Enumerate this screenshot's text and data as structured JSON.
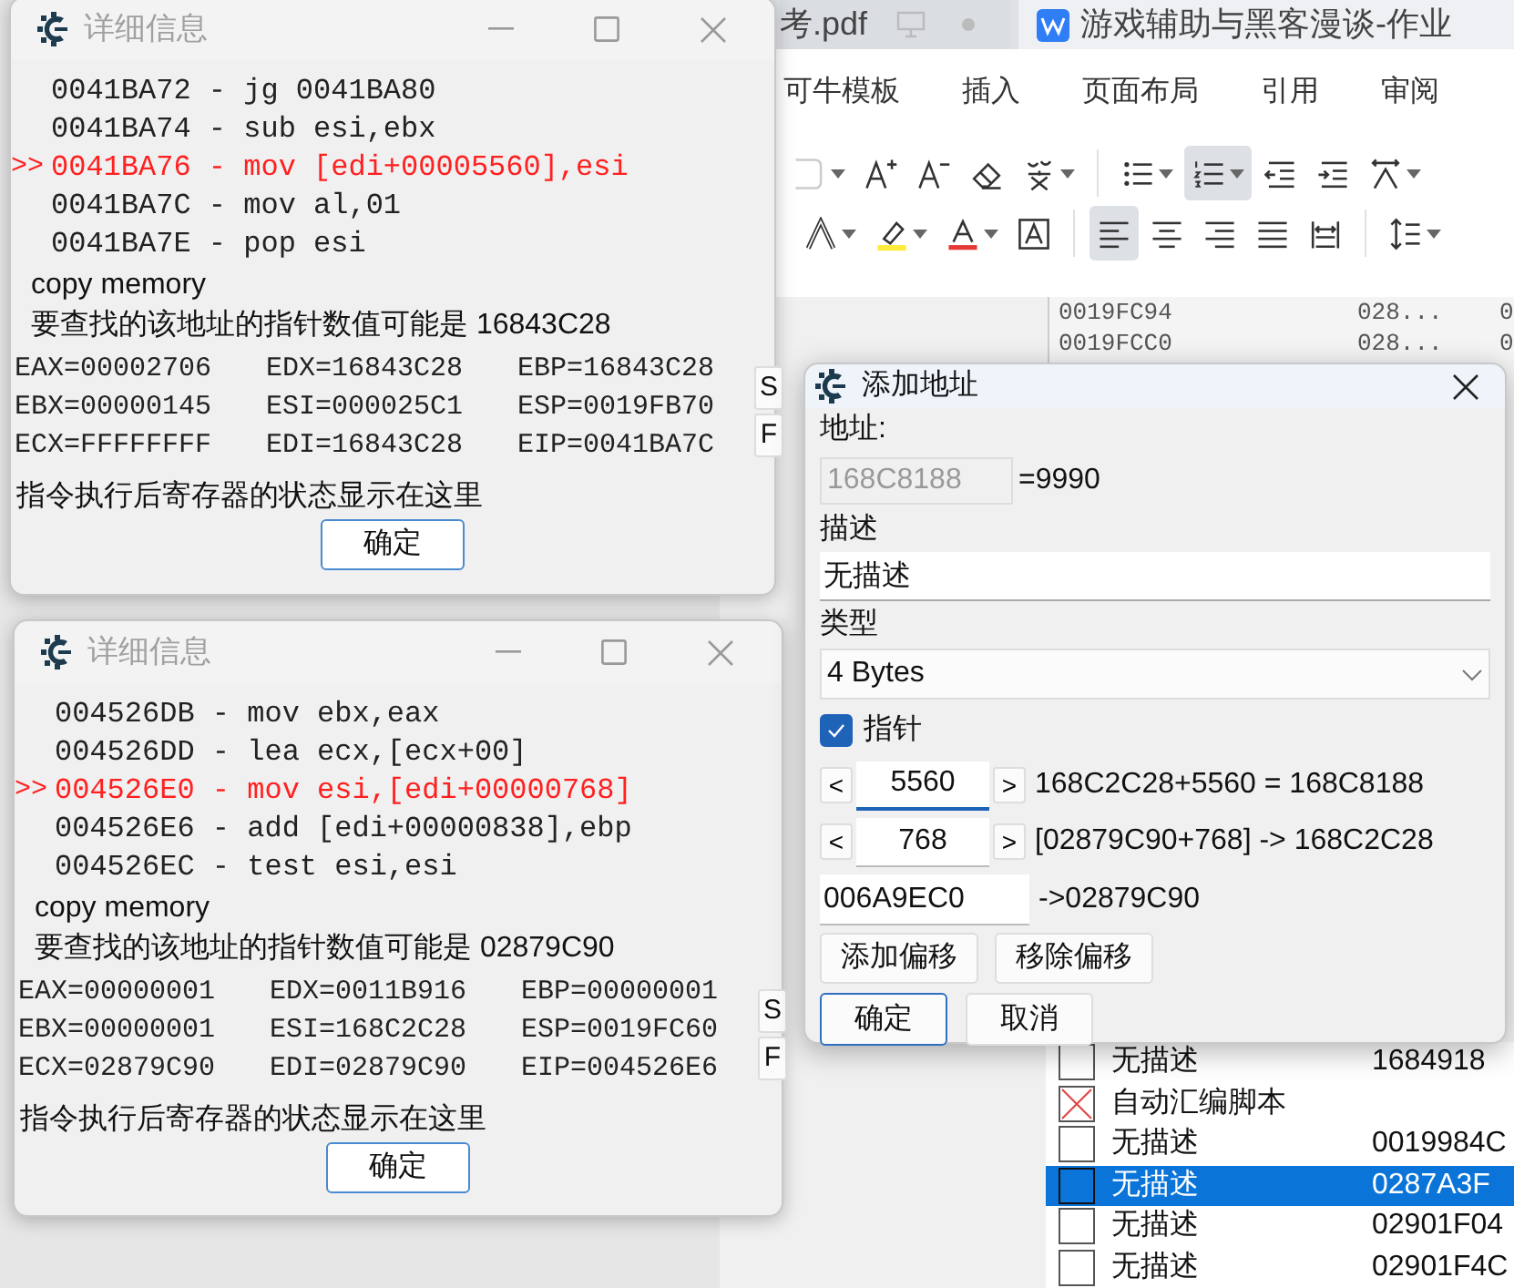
{
  "background_app": {
    "tabs": [
      {
        "label": "考.pdf",
        "selected": false
      },
      {
        "label": "游戏辅助与黑客漫谈-作业",
        "selected": true
      }
    ],
    "menu": [
      "可牛模板",
      "插入",
      "页面布局",
      "引用",
      "审阅"
    ],
    "toolbar_rows": [
      [
        {
          "kind": "font-size",
          "selected": false,
          "dropdown": true
        },
        {
          "kind": "grow-font",
          "selected": false,
          "dropdown": false
        },
        {
          "kind": "shrink-font",
          "selected": false,
          "dropdown": false
        },
        {
          "kind": "eraser",
          "selected": false,
          "dropdown": false
        },
        {
          "kind": "phonetic",
          "selected": false,
          "dropdown": true
        },
        {
          "kind": "separator"
        },
        {
          "kind": "bullets",
          "selected": false,
          "dropdown": true
        },
        {
          "kind": "numbering",
          "selected": true,
          "dropdown": true
        },
        {
          "kind": "outdent",
          "selected": false,
          "dropdown": false
        },
        {
          "kind": "indent",
          "selected": false,
          "dropdown": false
        },
        {
          "kind": "direction",
          "selected": false,
          "dropdown": true
        }
      ],
      [
        {
          "kind": "effect",
          "selected": false,
          "dropdown": true
        },
        {
          "kind": "highlight",
          "selected": false,
          "dropdown": true
        },
        {
          "kind": "font-color",
          "selected": false,
          "dropdown": true
        },
        {
          "kind": "border",
          "selected": false,
          "dropdown": false
        },
        {
          "kind": "separator"
        },
        {
          "kind": "align-left",
          "selected": true,
          "dropdown": false
        },
        {
          "kind": "align-center",
          "selected": false,
          "dropdown": false
        },
        {
          "kind": "align-right",
          "selected": false,
          "dropdown": false
        },
        {
          "kind": "justify",
          "selected": false,
          "dropdown": false
        },
        {
          "kind": "distribute",
          "selected": false,
          "dropdown": false
        },
        {
          "kind": "separator"
        },
        {
          "kind": "line-spacing",
          "selected": false,
          "dropdown": true
        }
      ]
    ]
  },
  "memory_list": {
    "rows": [
      {
        "address": "0019FC94",
        "value": "028...",
        "column_3": "0"
      },
      {
        "address": "0019FCC0",
        "value": "028...",
        "column_3": "0"
      }
    ]
  },
  "address_list": {
    "rows": [
      {
        "kind": "entry",
        "checked": false,
        "selected": false,
        "description": "无描述",
        "address": "1684918"
      },
      {
        "kind": "script",
        "selected": false,
        "description": "自动汇编脚本"
      },
      {
        "kind": "entry",
        "checked": false,
        "selected": false,
        "description": "无描述",
        "address": "0019984C"
      },
      {
        "kind": "entry",
        "checked": false,
        "selected": true,
        "description": "无描述",
        "address": "0287A3F"
      },
      {
        "kind": "entry",
        "checked": false,
        "selected": false,
        "description": "无描述",
        "address": "02901F04"
      },
      {
        "kind": "entry",
        "checked": false,
        "selected": false,
        "description": "无描述",
        "address": "02901F4C"
      }
    ]
  },
  "detail_windows": [
    {
      "title": "详细信息",
      "lines": [
        {
          "text": "0041BA72 - jg 0041BA80",
          "current": false
        },
        {
          "text": "0041BA74 - sub esi,ebx",
          "current": false
        },
        {
          "text": "0041BA76 - mov [edi+00005560],esi",
          "current": true,
          "marker": ">>"
        },
        {
          "text": "0041BA7C - mov al,01",
          "current": false
        },
        {
          "text": "0041BA7E - pop esi",
          "current": false
        }
      ],
      "caption": "copy memory",
      "hint": "要查找的该地址的指针数值可能是 16843C28",
      "registers": [
        "EAX=00002706",
        "EDX=16843C28",
        "EBP=16843C28",
        "EBX=00000145",
        "ESI=000025C1",
        "ESP=0019FB70",
        "ECX=FFFFFFFF",
        "EDI=16843C28",
        "EIP=0041BA7C"
      ],
      "side_buttons": [
        "S",
        "F"
      ],
      "footer": "指令执行后寄存器的状态显示在这里",
      "ok": "确定"
    },
    {
      "title": "详细信息",
      "lines": [
        {
          "text": "004526DB - mov ebx,eax",
          "current": false
        },
        {
          "text": "004526DD - lea ecx,[ecx+00]",
          "current": false
        },
        {
          "text": "004526E0 - mov esi,[edi+00000768]",
          "current": true,
          "marker": ">>"
        },
        {
          "text": "004526E6 - add [edi+00000838],ebp",
          "current": false
        },
        {
          "text": "004526EC - test esi,esi",
          "current": false
        }
      ],
      "caption": "copy memory",
      "hint": "要查找的该地址的指针数值可能是 02879C90",
      "registers": [
        "EAX=00000001",
        "EDX=0011B916",
        "EBP=00000001",
        "EBX=00000001",
        "ESI=168C2C28",
        "ESP=0019FC60",
        "ECX=02879C90",
        "EDI=02879C90",
        "EIP=004526E6"
      ],
      "side_buttons": [
        "S",
        "F"
      ],
      "footer": "指令执行后寄存器的状态显示在这里",
      "ok": "确定"
    }
  ],
  "add_address_dialog": {
    "title": "添加地址",
    "address_label": "地址:",
    "address_value": "168C8188",
    "address_result": "=9990",
    "description_label": "描述",
    "description_value": "无描述",
    "type_label": "类型",
    "type_value": "4 Bytes",
    "pointer": {
      "label": "指针",
      "checked": true
    },
    "offsets": [
      {
        "dec": "<",
        "value": "5560",
        "inc": ">",
        "focused": true,
        "formula": "168C2C28+5560 = 168C8188"
      },
      {
        "dec": "<",
        "value": "768",
        "inc": ">",
        "focused": false,
        "formula": "[02879C90+768] -> 168C2C28"
      }
    ],
    "base": {
      "value": "006A9EC0",
      "result": "->02879C90"
    },
    "offset_buttons": [
      "添加偏移",
      "移除偏移"
    ],
    "buttons": [
      {
        "label": "确定",
        "default": true
      },
      {
        "label": "取消",
        "default": false
      }
    ]
  }
}
